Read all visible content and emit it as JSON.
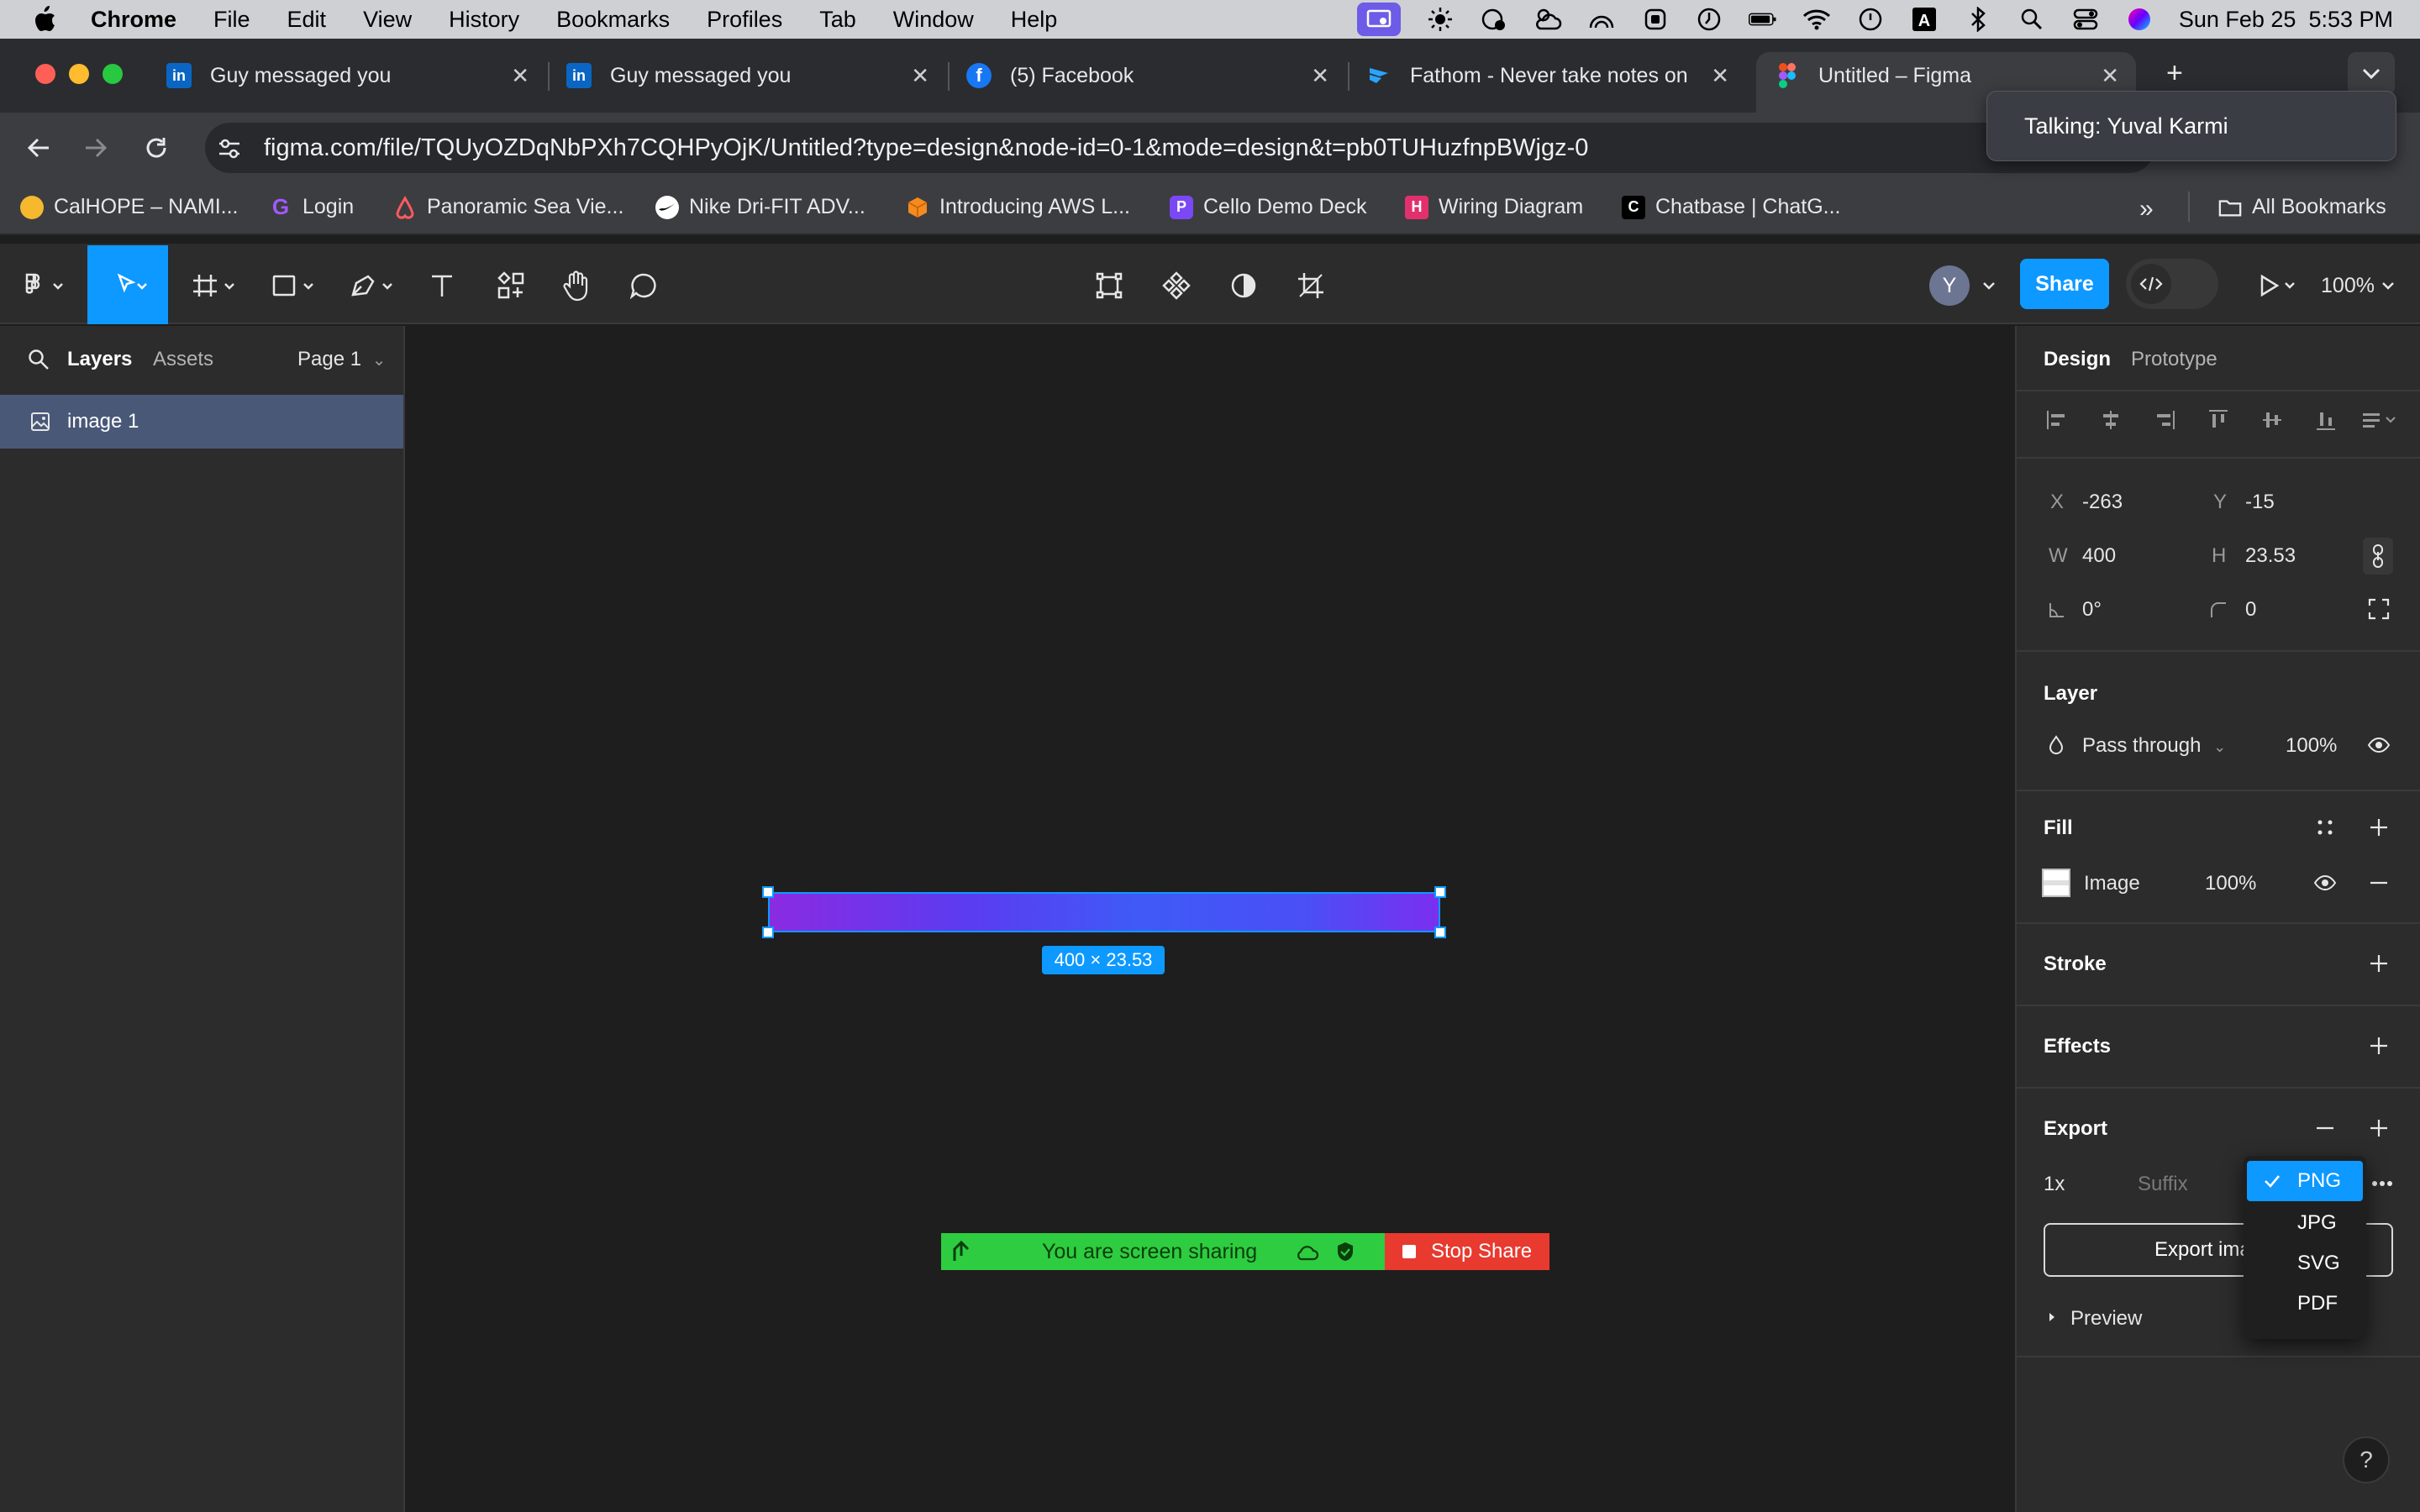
{
  "menubar": {
    "app": "Chrome",
    "items": [
      "File",
      "Edit",
      "View",
      "History",
      "Bookmarks",
      "Profiles",
      "Tab",
      "Window",
      "Help"
    ],
    "clock": "Sun Feb 25  5:53 PM"
  },
  "tabs": [
    {
      "title": "Guy messaged you",
      "icon": "linkedin-icon"
    },
    {
      "title": "Guy messaged you",
      "icon": "linkedin-icon"
    },
    {
      "title": "(5) Facebook",
      "icon": "facebook-icon"
    },
    {
      "title": "Fathom - Never take notes on",
      "icon": "fathom-icon"
    },
    {
      "title": "Untitled – Figma",
      "icon": "figma-icon"
    }
  ],
  "address": {
    "url": "figma.com/file/TQUyOZDqNbPXh7CQHPyOjK/Untitled?type=design&node-id=0-1&mode=design&t=pb0TUHuzfnpBWjgz-0"
  },
  "talking": "Talking: Yuval Karmi",
  "bookmarks": [
    {
      "label": "CalHOPE – NAMI..."
    },
    {
      "label": "Login"
    },
    {
      "label": "Panoramic Sea Vie..."
    },
    {
      "label": "Nike Dri-FIT ADV..."
    },
    {
      "label": "Introducing AWS L..."
    },
    {
      "label": "Cello Demo Deck"
    },
    {
      "label": "Wiring Diagram"
    },
    {
      "label": "Chatbase | ChatG..."
    }
  ],
  "bookmarks_all": "All Bookmarks",
  "figma_toolbar": {
    "avatar_letter": "Y",
    "share_label": "Share",
    "zoom": "100%"
  },
  "left_panel": {
    "tab_layers": "Layers",
    "tab_assets": "Assets",
    "page": "Page 1",
    "layer_name": "image 1"
  },
  "canvas": {
    "dimension_label": "400 × 23.53",
    "share_notice": "You are screen sharing",
    "stop_share": "Stop Share"
  },
  "right_panel": {
    "tab_design": "Design",
    "tab_prototype": "Prototype",
    "x_label": "X",
    "x_value": "-263",
    "y_label": "Y",
    "y_value": "-15",
    "w_label": "W",
    "w_value": "400",
    "h_label": "H",
    "h_value": "23.53",
    "rotation": "0°",
    "radius": "0",
    "layer_title": "Layer",
    "blend_mode": "Pass through",
    "layer_opacity": "100%",
    "fill_title": "Fill",
    "fill_type": "Image",
    "fill_opacity": "100%",
    "stroke_title": "Stroke",
    "effects_title": "Effects",
    "export_title": "Export",
    "export_scale": "1x",
    "suffix_placeholder": "Suffix",
    "export_button": "Export ima",
    "preview_label": "Preview",
    "formats": [
      "PNG",
      "JPG",
      "SVG",
      "PDF"
    ],
    "selected_format": "PNG"
  },
  "help": "?"
}
